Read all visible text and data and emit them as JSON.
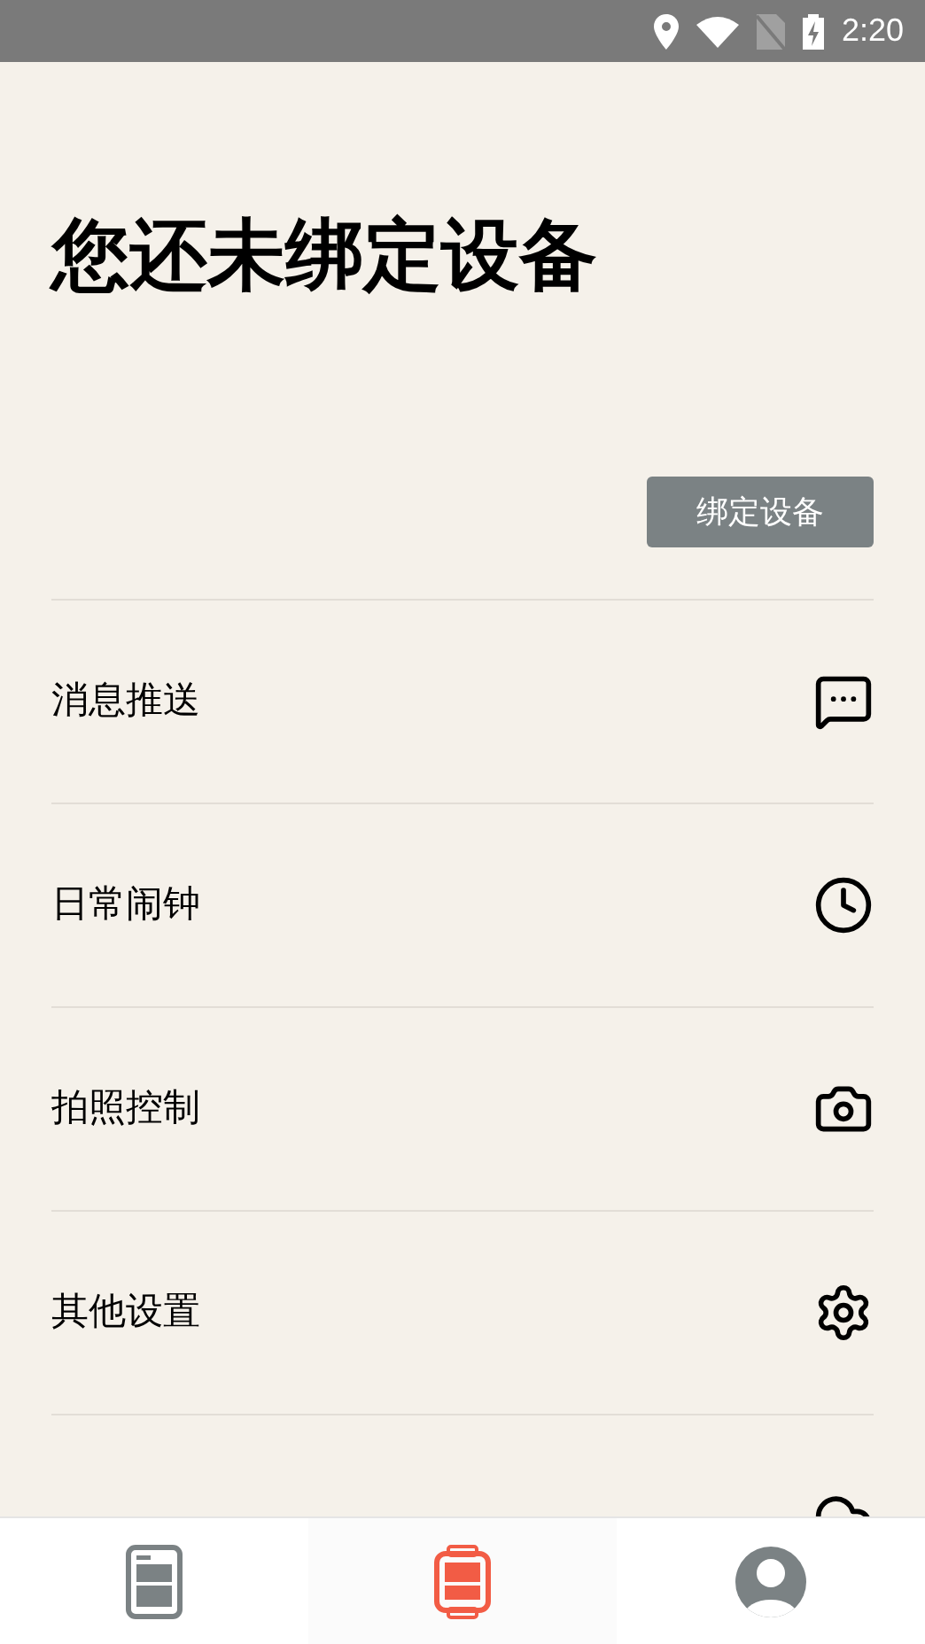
{
  "status_bar": {
    "time": "2:20"
  },
  "title": "您还未绑定设备",
  "bind_button": "绑定设备",
  "menu": [
    {
      "label": "消息推送"
    },
    {
      "label": "日常闹钟"
    },
    {
      "label": "拍照控制"
    },
    {
      "label": "其他设置"
    }
  ],
  "nav_tabs": [
    {
      "selected": false
    },
    {
      "selected": true
    },
    {
      "selected": false
    }
  ]
}
